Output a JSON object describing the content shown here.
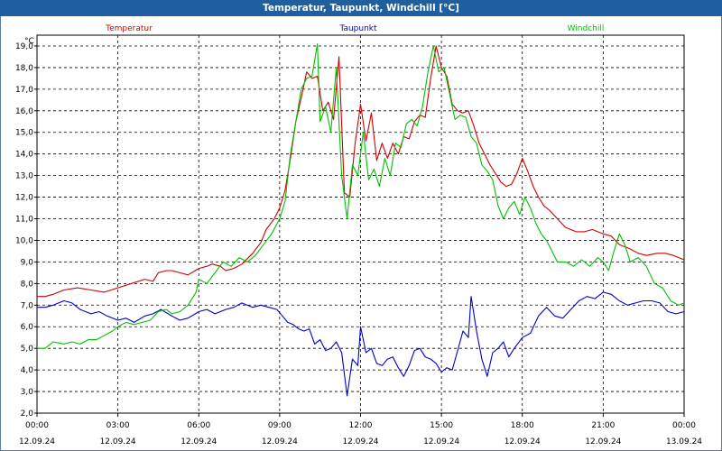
{
  "window": {
    "title": "Temperatur, Taupunkt, Windchill [°C]"
  },
  "chart_data": {
    "type": "line",
    "title": "Temperatur, Taupunkt, Windchill [°C]",
    "ylabel": "°C",
    "xlabel": "",
    "ylim": [
      2.0,
      19.5
    ],
    "xlim_hours": [
      0,
      24
    ],
    "grid": true,
    "legend_placement": "top",
    "y_ticks": [
      "2,0",
      "3,0",
      "4,0",
      "5,0",
      "6,0",
      "7,0",
      "8,0",
      "9,0",
      "10,0",
      "11,0",
      "12,0",
      "13,0",
      "14,0",
      "15,0",
      "16,0",
      "17,0",
      "18,0",
      "19,0"
    ],
    "x_ticks": [
      {
        "time": "00:00",
        "date": "12.09.24"
      },
      {
        "time": "03:00",
        "date": "12.09.24"
      },
      {
        "time": "06:00",
        "date": "12.09.24"
      },
      {
        "time": "09:00",
        "date": "12.09.24"
      },
      {
        "time": "12:00",
        "date": "12.09.24"
      },
      {
        "time": "15:00",
        "date": "12.09.24"
      },
      {
        "time": "18:00",
        "date": "12.09.24"
      },
      {
        "time": "21:00",
        "date": "12.09.24"
      },
      {
        "time": "00:00",
        "date": "13.09.24"
      }
    ],
    "series": [
      {
        "name": "Temperatur",
        "color": "#d00000",
        "points": [
          [
            0,
            7.4
          ],
          [
            0.3,
            7.4
          ],
          [
            0.6,
            7.5
          ],
          [
            1.0,
            7.7
          ],
          [
            1.5,
            7.8
          ],
          [
            2.0,
            7.7
          ],
          [
            2.5,
            7.6
          ],
          [
            3.0,
            7.8
          ],
          [
            3.5,
            8.0
          ],
          [
            4.0,
            8.2
          ],
          [
            4.3,
            8.1
          ],
          [
            4.5,
            8.5
          ],
          [
            4.8,
            8.6
          ],
          [
            5.0,
            8.6
          ],
          [
            5.3,
            8.5
          ],
          [
            5.6,
            8.4
          ],
          [
            6.0,
            8.7
          ],
          [
            6.3,
            8.8
          ],
          [
            6.5,
            8.9
          ],
          [
            6.8,
            8.8
          ],
          [
            7.0,
            8.6
          ],
          [
            7.3,
            8.7
          ],
          [
            7.6,
            8.9
          ],
          [
            8.0,
            9.4
          ],
          [
            8.3,
            9.9
          ],
          [
            8.5,
            10.5
          ],
          [
            8.8,
            11.0
          ],
          [
            9.0,
            11.5
          ],
          [
            9.2,
            12.3
          ],
          [
            9.4,
            13.8
          ],
          [
            9.6,
            15.5
          ],
          [
            9.8,
            16.6
          ],
          [
            10.0,
            17.8
          ],
          [
            10.2,
            17.5
          ],
          [
            10.4,
            17.6
          ],
          [
            10.6,
            16.0
          ],
          [
            10.8,
            16.4
          ],
          [
            11.0,
            15.6
          ],
          [
            11.2,
            18.5
          ],
          [
            11.4,
            12.2
          ],
          [
            11.6,
            12.0
          ],
          [
            11.8,
            14.5
          ],
          [
            12.0,
            16.3
          ],
          [
            12.2,
            14.6
          ],
          [
            12.4,
            15.9
          ],
          [
            12.6,
            13.7
          ],
          [
            12.8,
            14.5
          ],
          [
            13.0,
            13.8
          ],
          [
            13.2,
            14.5
          ],
          [
            13.4,
            14.0
          ],
          [
            13.6,
            14.8
          ],
          [
            13.8,
            14.7
          ],
          [
            14.0,
            15.5
          ],
          [
            14.2,
            15.8
          ],
          [
            14.4,
            15.7
          ],
          [
            14.6,
            17.5
          ],
          [
            14.8,
            19.0
          ],
          [
            15.0,
            18.0
          ],
          [
            15.2,
            17.6
          ],
          [
            15.4,
            16.3
          ],
          [
            15.6,
            16.0
          ],
          [
            15.8,
            15.9
          ],
          [
            16.0,
            16.0
          ],
          [
            16.2,
            15.3
          ],
          [
            16.4,
            14.5
          ],
          [
            16.6,
            14.0
          ],
          [
            16.8,
            13.5
          ],
          [
            17.0,
            13.1
          ],
          [
            17.2,
            12.7
          ],
          [
            17.4,
            12.5
          ],
          [
            17.6,
            12.6
          ],
          [
            17.8,
            13.1
          ],
          [
            18.0,
            13.8
          ],
          [
            18.2,
            13.2
          ],
          [
            18.4,
            12.5
          ],
          [
            18.6,
            12.0
          ],
          [
            18.8,
            11.6
          ],
          [
            19.0,
            11.4
          ],
          [
            19.3,
            11.0
          ],
          [
            19.6,
            10.6
          ],
          [
            20.0,
            10.4
          ],
          [
            20.3,
            10.4
          ],
          [
            20.6,
            10.5
          ],
          [
            21.0,
            10.3
          ],
          [
            21.3,
            10.2
          ],
          [
            21.6,
            9.8
          ],
          [
            22.0,
            9.6
          ],
          [
            22.3,
            9.4
          ],
          [
            22.6,
            9.3
          ],
          [
            23.0,
            9.4
          ],
          [
            23.3,
            9.4
          ],
          [
            23.6,
            9.3
          ],
          [
            24.0,
            9.1
          ]
        ]
      },
      {
        "name": "Taupunkt",
        "color": "#0000cc",
        "points": [
          [
            0,
            6.9
          ],
          [
            0.3,
            6.9
          ],
          [
            0.6,
            7.0
          ],
          [
            1.0,
            7.2
          ],
          [
            1.3,
            7.1
          ],
          [
            1.6,
            6.8
          ],
          [
            2.0,
            6.6
          ],
          [
            2.3,
            6.7
          ],
          [
            2.6,
            6.5
          ],
          [
            3.0,
            6.3
          ],
          [
            3.3,
            6.4
          ],
          [
            3.6,
            6.2
          ],
          [
            4.0,
            6.5
          ],
          [
            4.3,
            6.6
          ],
          [
            4.6,
            6.8
          ],
          [
            5.0,
            6.5
          ],
          [
            5.3,
            6.3
          ],
          [
            5.6,
            6.4
          ],
          [
            6.0,
            6.7
          ],
          [
            6.3,
            6.8
          ],
          [
            6.6,
            6.6
          ],
          [
            7.0,
            6.8
          ],
          [
            7.3,
            6.9
          ],
          [
            7.6,
            7.1
          ],
          [
            8.0,
            6.9
          ],
          [
            8.3,
            7.0
          ],
          [
            8.6,
            6.9
          ],
          [
            8.9,
            6.8
          ],
          [
            9.1,
            6.5
          ],
          [
            9.3,
            6.2
          ],
          [
            9.5,
            6.1
          ],
          [
            9.7,
            5.9
          ],
          [
            9.9,
            5.8
          ],
          [
            10.1,
            5.9
          ],
          [
            10.3,
            5.2
          ],
          [
            10.5,
            5.4
          ],
          [
            10.7,
            4.9
          ],
          [
            10.9,
            5.0
          ],
          [
            11.1,
            5.3
          ],
          [
            11.3,
            4.8
          ],
          [
            11.5,
            2.8
          ],
          [
            11.7,
            4.5
          ],
          [
            11.9,
            4.2
          ],
          [
            12.0,
            6.0
          ],
          [
            12.2,
            4.8
          ],
          [
            12.4,
            5.0
          ],
          [
            12.6,
            4.3
          ],
          [
            12.8,
            4.2
          ],
          [
            13.0,
            4.5
          ],
          [
            13.2,
            4.6
          ],
          [
            13.4,
            4.1
          ],
          [
            13.6,
            3.7
          ],
          [
            13.8,
            4.2
          ],
          [
            14.0,
            4.9
          ],
          [
            14.2,
            5.0
          ],
          [
            14.4,
            4.6
          ],
          [
            14.6,
            4.5
          ],
          [
            14.8,
            4.3
          ],
          [
            15.0,
            3.9
          ],
          [
            15.2,
            4.1
          ],
          [
            15.4,
            4.0
          ],
          [
            15.6,
            4.9
          ],
          [
            15.8,
            5.8
          ],
          [
            16.0,
            5.5
          ],
          [
            16.1,
            7.4
          ],
          [
            16.3,
            5.8
          ],
          [
            16.5,
            4.5
          ],
          [
            16.7,
            3.7
          ],
          [
            16.9,
            4.8
          ],
          [
            17.1,
            5.0
          ],
          [
            17.3,
            5.3
          ],
          [
            17.5,
            4.6
          ],
          [
            17.7,
            5.0
          ],
          [
            18.0,
            5.5
          ],
          [
            18.3,
            5.7
          ],
          [
            18.6,
            6.5
          ],
          [
            18.9,
            6.9
          ],
          [
            19.2,
            6.5
          ],
          [
            19.5,
            6.4
          ],
          [
            19.8,
            6.8
          ],
          [
            20.1,
            7.2
          ],
          [
            20.4,
            7.4
          ],
          [
            20.7,
            7.3
          ],
          [
            21.0,
            7.6
          ],
          [
            21.3,
            7.5
          ],
          [
            21.6,
            7.2
          ],
          [
            21.9,
            7.0
          ],
          [
            22.2,
            7.1
          ],
          [
            22.5,
            7.2
          ],
          [
            22.8,
            7.2
          ],
          [
            23.1,
            7.1
          ],
          [
            23.4,
            6.7
          ],
          [
            23.7,
            6.6
          ],
          [
            24.0,
            6.7
          ]
        ]
      },
      {
        "name": "Windchill",
        "color": "#00c000",
        "points": [
          [
            0,
            5.0
          ],
          [
            0.3,
            5.0
          ],
          [
            0.6,
            5.3
          ],
          [
            1.0,
            5.2
          ],
          [
            1.3,
            5.3
          ],
          [
            1.6,
            5.2
          ],
          [
            1.9,
            5.4
          ],
          [
            2.2,
            5.4
          ],
          [
            2.5,
            5.6
          ],
          [
            2.8,
            5.8
          ],
          [
            3.0,
            6.0
          ],
          [
            3.3,
            6.2
          ],
          [
            3.6,
            6.1
          ],
          [
            3.9,
            6.2
          ],
          [
            4.2,
            6.3
          ],
          [
            4.5,
            6.7
          ],
          [
            4.8,
            6.8
          ],
          [
            5.0,
            6.6
          ],
          [
            5.3,
            6.7
          ],
          [
            5.6,
            7.0
          ],
          [
            5.9,
            7.6
          ],
          [
            6.0,
            8.2
          ],
          [
            6.3,
            8.0
          ],
          [
            6.6,
            8.5
          ],
          [
            6.9,
            9.0
          ],
          [
            7.2,
            8.8
          ],
          [
            7.5,
            9.2
          ],
          [
            7.8,
            9.0
          ],
          [
            8.1,
            9.3
          ],
          [
            8.4,
            9.8
          ],
          [
            8.7,
            10.3
          ],
          [
            9.0,
            11.0
          ],
          [
            9.2,
            11.8
          ],
          [
            9.4,
            14.0
          ],
          [
            9.6,
            15.5
          ],
          [
            9.8,
            17.0
          ],
          [
            10.0,
            17.5
          ],
          [
            10.2,
            17.6
          ],
          [
            10.4,
            19.1
          ],
          [
            10.5,
            15.5
          ],
          [
            10.7,
            16.2
          ],
          [
            10.9,
            15.0
          ],
          [
            11.1,
            18.0
          ],
          [
            11.3,
            13.0
          ],
          [
            11.5,
            11.0
          ],
          [
            11.7,
            13.5
          ],
          [
            11.9,
            13.0
          ],
          [
            12.1,
            15.0
          ],
          [
            12.3,
            12.8
          ],
          [
            12.5,
            13.3
          ],
          [
            12.7,
            12.5
          ],
          [
            12.9,
            13.8
          ],
          [
            13.1,
            13.0
          ],
          [
            13.3,
            14.5
          ],
          [
            13.5,
            14.3
          ],
          [
            13.7,
            15.4
          ],
          [
            13.9,
            15.6
          ],
          [
            14.1,
            15.3
          ],
          [
            14.3,
            16.2
          ],
          [
            14.5,
            17.8
          ],
          [
            14.7,
            19.0
          ],
          [
            14.9,
            17.8
          ],
          [
            15.1,
            18.0
          ],
          [
            15.3,
            16.8
          ],
          [
            15.5,
            15.6
          ],
          [
            15.7,
            15.8
          ],
          [
            15.9,
            15.7
          ],
          [
            16.1,
            14.8
          ],
          [
            16.3,
            14.5
          ],
          [
            16.5,
            13.5
          ],
          [
            16.7,
            13.2
          ],
          [
            16.9,
            12.8
          ],
          [
            17.1,
            11.6
          ],
          [
            17.3,
            11.0
          ],
          [
            17.5,
            11.5
          ],
          [
            17.7,
            11.8
          ],
          [
            17.9,
            11.2
          ],
          [
            18.1,
            12.0
          ],
          [
            18.3,
            11.5
          ],
          [
            18.5,
            10.8
          ],
          [
            18.7,
            10.3
          ],
          [
            18.9,
            10.0
          ],
          [
            19.1,
            9.5
          ],
          [
            19.3,
            9.0
          ],
          [
            19.6,
            9.0
          ],
          [
            19.9,
            8.8
          ],
          [
            20.2,
            9.1
          ],
          [
            20.5,
            8.8
          ],
          [
            20.8,
            9.2
          ],
          [
            21.0,
            9.0
          ],
          [
            21.2,
            8.6
          ],
          [
            21.4,
            9.5
          ],
          [
            21.6,
            10.3
          ],
          [
            21.8,
            9.8
          ],
          [
            22.0,
            9.0
          ],
          [
            22.3,
            9.2
          ],
          [
            22.6,
            8.8
          ],
          [
            22.9,
            8.0
          ],
          [
            23.2,
            7.8
          ],
          [
            23.5,
            7.2
          ],
          [
            23.8,
            7.0
          ],
          [
            24.0,
            7.1
          ]
        ]
      }
    ]
  }
}
